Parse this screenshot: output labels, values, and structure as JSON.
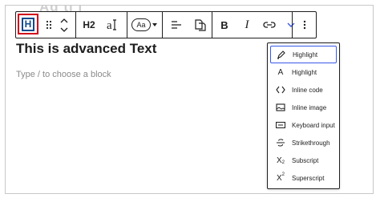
{
  "toolbar": {
    "block_type_letter": "H",
    "heading_level": "H2",
    "font_size_label": "Aa",
    "bold_label": "B",
    "italic_label": "I"
  },
  "editor": {
    "ghost_title": "Ad ti l",
    "heading_text": "This is advanced Text",
    "placeholder_text": "Type / to choose a block"
  },
  "format_menu": {
    "items": [
      {
        "label": "Highlight",
        "icon": "highlighter-icon"
      },
      {
        "label": "Highlight",
        "icon": "letter-a-icon"
      },
      {
        "label": "Inline code",
        "icon": "code-icon"
      },
      {
        "label": "Inline image",
        "icon": "image-icon"
      },
      {
        "label": "Keyboard input",
        "icon": "keyboard-icon"
      },
      {
        "label": "Strikethrough",
        "icon": "strikethrough-icon"
      },
      {
        "label": "Subscript",
        "icon": "subscript-icon"
      },
      {
        "label": "Superscript",
        "icon": "superscript-icon"
      }
    ],
    "subscript_glyph": "X",
    "subscript_mark": "2",
    "superscript_glyph": "X",
    "superscript_mark": "2",
    "letter_a": "A"
  },
  "colors": {
    "accent": "#3858e9",
    "block_icon_blue": "#0c4a8c",
    "selection_red": "#d0021b"
  }
}
